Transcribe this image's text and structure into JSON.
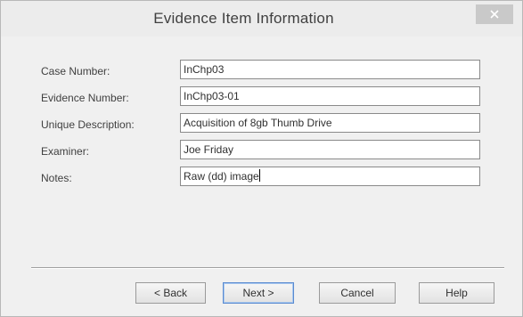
{
  "window": {
    "title": "Evidence Item Information",
    "close_glyph": "×"
  },
  "form": {
    "fields": [
      {
        "label": "Case Number:",
        "value": "InChp03"
      },
      {
        "label": "Evidence Number:",
        "value": "InChp03-01"
      },
      {
        "label": "Unique Description:",
        "value": "Acquisition of 8gb Thumb Drive"
      },
      {
        "label": "Examiner:",
        "value": "Joe Friday"
      },
      {
        "label": "Notes:",
        "value": "Raw (dd) image"
      }
    ]
  },
  "buttons": {
    "back": "< Back",
    "next": "Next >",
    "cancel": "Cancel",
    "help": "Help"
  },
  "colors": {
    "window_bg": "#f0f0f0",
    "close_bg": "#c9c9c9",
    "default_button_border": "#5a8bd0"
  }
}
